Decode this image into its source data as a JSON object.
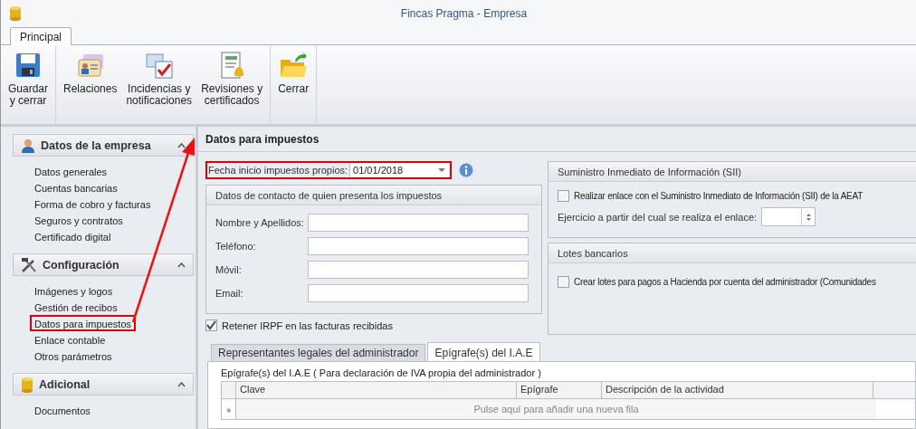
{
  "window": {
    "title": "Fincas Pragma - Empresa"
  },
  "ribbon": {
    "tabs": [
      {
        "label": "Principal",
        "selected": true
      }
    ],
    "groups": [
      [
        {
          "label": "Guardar\ny cerrar"
        }
      ],
      [
        {
          "label": "Relaciones"
        },
        {
          "label": "Incidencias y\nnotificaciones"
        },
        {
          "label": "Revisiones y\ncertificados"
        }
      ],
      [
        {
          "label": "Cerrar"
        }
      ]
    ]
  },
  "sidebar": {
    "groups": [
      {
        "title": "Datos de la empresa",
        "expanded": true,
        "items": [
          {
            "label": "Datos generales",
            "highlighted": false
          },
          {
            "label": "Cuentas bancarias",
            "highlighted": false
          },
          {
            "label": "Forma de cobro y facturas",
            "highlighted": false
          },
          {
            "label": "Seguros y contratos",
            "highlighted": false
          },
          {
            "label": "Certificado digital",
            "highlighted": false
          }
        ]
      },
      {
        "title": "Configuración",
        "expanded": true,
        "items": [
          {
            "label": "Imágenes y logos",
            "highlighted": false
          },
          {
            "label": "Gestión de recibos",
            "highlighted": false
          },
          {
            "label": "Datos para impuestos",
            "highlighted": true
          },
          {
            "label": "Enlace contable",
            "highlighted": false
          },
          {
            "label": "Otros parámetros",
            "highlighted": false
          }
        ]
      },
      {
        "title": "Adicional",
        "expanded": true,
        "items": [
          {
            "label": "Documentos",
            "highlighted": false
          }
        ]
      }
    ]
  },
  "content": {
    "title": "Datos para impuestos",
    "start_date": {
      "label": "Fecha inicio impuestos propios:",
      "value": "01/01/2018",
      "highlighted": true
    },
    "contact_group": {
      "title": "Datos de contacto de quien presenta los impuestos",
      "fields": [
        {
          "label": "Nombre y Apellidos:"
        },
        {
          "label": "Teléfono:"
        },
        {
          "label": "Móvil:"
        },
        {
          "label": "Email:"
        }
      ]
    },
    "retain_irpf": {
      "label": "Retener IRPF en las facturas recibidas",
      "checked": true
    },
    "sii_group": {
      "title": "Suministro Inmediato de Información (SII)",
      "checkbox": {
        "label": "Realizar enlace con el Suministro Inmediato de Información (SII) de la AEAT",
        "checked": false
      },
      "year_label": "Ejercicio a partir del cual se realiza el enlace:"
    },
    "lotes_group": {
      "title": "Lotes bancarios",
      "checkbox": {
        "label": "Crear lotes para pagos a Hacienda por cuenta del administrador (Comunidades",
        "checked": false
      }
    },
    "tabs": [
      {
        "label": "Representantes legales del administrador",
        "selected": false
      },
      {
        "label": "Epígrafe(s) del I.A.E",
        "selected": true
      }
    ],
    "grid_caption": "Epígrafe(s) del I.A.E ( Para declaración de IVA propia del administrador )",
    "table": {
      "columns": [
        "Clave",
        "Epígrafe",
        "Descripción de la actividad"
      ],
      "new_row_marker": "⁕",
      "new_row_hint": "Pulse aquí para añadir una nueva fila"
    }
  }
}
